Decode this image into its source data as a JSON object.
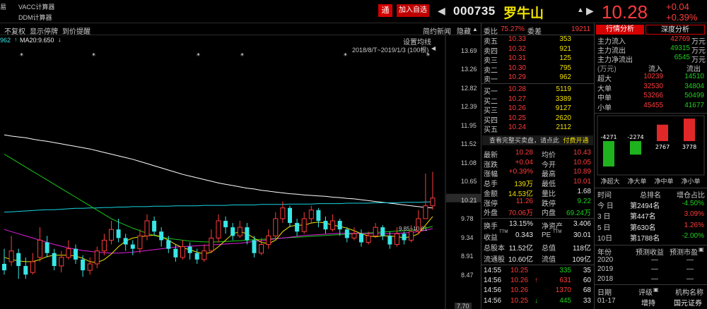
{
  "topbar": {
    "left_char": "易",
    "menu1": "VACC计算器",
    "menu2": "DDM计算器",
    "tong_label": "通",
    "add_fav_label": "加入自选",
    "prev_arrow": "◀",
    "stock_code": "000735",
    "stock_name": "罗牛山",
    "up_icon": "▲",
    "next_arrow": "▶",
    "price": "10.28",
    "change_abs": "+0.04",
    "change_pct": "+0.39%"
  },
  "chart_toolbar": {
    "no_adjust": "不复权",
    "show_suspend": "显示停牌",
    "to_price_alert": "到价提醒",
    "brief_news": "简约新闻",
    "hide": "隐藏",
    "hide_arrow": "▲"
  },
  "chart": {
    "ma_left": "962",
    "ma20_label": "MA20:9.650",
    "settings_label": "设置均线",
    "range_label": "2018/8/T~2019/1/3 (100根)",
    "range_label_end": "◀",
    "range_marker": "9.85~10.01",
    "bottom_value": "7.70",
    "y_labels": [
      "13.69",
      "13.26",
      "12.82",
      "12.39",
      "11.95",
      "11.52",
      "11.08",
      "10.65",
      "10.21",
      "9.78",
      "9.34",
      "8.91",
      "8.47"
    ]
  },
  "chart_data": {
    "type": "candlestick",
    "y_ticks": [
      13.69,
      13.26,
      12.82,
      12.39,
      11.95,
      11.52,
      11.08,
      10.65,
      10.21,
      9.78,
      9.34,
      8.91,
      8.47
    ],
    "ylim": [
      7.7,
      13.9
    ],
    "candles": [
      {
        "o": 8.75,
        "c": 8.6,
        "h": 9.1,
        "l": 8.5
      },
      {
        "o": 8.8,
        "c": 9.05,
        "h": 9.4,
        "l": 8.7
      },
      {
        "o": 9.0,
        "c": 8.7,
        "h": 9.1,
        "l": 8.4
      },
      {
        "o": 8.7,
        "c": 8.5,
        "h": 8.9,
        "l": 8.4
      },
      {
        "o": 8.55,
        "c": 8.8,
        "h": 9.0,
        "l": 8.5
      },
      {
        "o": 8.9,
        "c": 9.3,
        "h": 9.6,
        "l": 8.8
      },
      {
        "o": 9.25,
        "c": 9.0,
        "h": 9.4,
        "l": 8.9
      },
      {
        "o": 9.0,
        "c": 8.7,
        "h": 9.1,
        "l": 8.6
      },
      {
        "o": 8.7,
        "c": 8.9,
        "h": 9.05,
        "l": 8.55
      },
      {
        "o": 8.9,
        "c": 9.1,
        "h": 9.3,
        "l": 8.85
      },
      {
        "o": 9.1,
        "c": 8.85,
        "h": 9.2,
        "l": 8.75
      },
      {
        "o": 8.85,
        "c": 8.6,
        "h": 8.95,
        "l": 8.45
      },
      {
        "o": 8.6,
        "c": 8.75,
        "h": 8.9,
        "l": 8.5
      },
      {
        "o": 8.75,
        "c": 9.05,
        "h": 9.15,
        "l": 8.65
      },
      {
        "o": 9.05,
        "c": 9.3,
        "h": 9.45,
        "l": 8.95
      },
      {
        "o": 9.3,
        "c": 9.55,
        "h": 9.75,
        "l": 9.2
      },
      {
        "o": 9.55,
        "c": 9.35,
        "h": 9.8,
        "l": 9.25
      },
      {
        "o": 9.35,
        "c": 9.2,
        "h": 9.45,
        "l": 9.05
      },
      {
        "o": 9.2,
        "c": 9.1,
        "h": 9.3,
        "l": 8.95
      },
      {
        "o": 9.1,
        "c": 9.4,
        "h": 9.55,
        "l": 9.0
      },
      {
        "o": 9.4,
        "c": 9.75,
        "h": 9.9,
        "l": 9.3
      },
      {
        "o": 9.75,
        "c": 9.5,
        "h": 9.85,
        "l": 9.4
      },
      {
        "o": 9.5,
        "c": 9.3,
        "h": 9.6,
        "l": 9.15
      },
      {
        "o": 9.3,
        "c": 9.1,
        "h": 9.4,
        "l": 9.0
      },
      {
        "o": 9.1,
        "c": 8.9,
        "h": 9.2,
        "l": 8.8
      },
      {
        "o": 8.9,
        "c": 9.15,
        "h": 9.3,
        "l": 8.85
      },
      {
        "o": 9.15,
        "c": 9.0,
        "h": 9.25,
        "l": 8.85
      },
      {
        "o": 9.0,
        "c": 8.85,
        "h": 9.1,
        "l": 8.75
      },
      {
        "o": 8.85,
        "c": 9.05,
        "h": 9.2,
        "l": 8.8
      },
      {
        "o": 9.05,
        "c": 9.35,
        "h": 9.55,
        "l": 9.0
      },
      {
        "o": 9.35,
        "c": 9.75,
        "h": 9.9,
        "l": 9.25
      },
      {
        "o": 9.75,
        "c": 9.6,
        "h": 9.85,
        "l": 9.45
      },
      {
        "o": 9.6,
        "c": 9.4,
        "h": 9.7,
        "l": 9.3
      },
      {
        "o": 9.4,
        "c": 9.6,
        "h": 9.75,
        "l": 9.35
      },
      {
        "o": 9.6,
        "c": 9.3,
        "h": 9.7,
        "l": 9.2
      },
      {
        "o": 9.3,
        "c": 9.0,
        "h": 9.4,
        "l": 8.9
      },
      {
        "o": 9.0,
        "c": 9.2,
        "h": 9.35,
        "l": 8.95
      },
      {
        "o": 9.2,
        "c": 9.4,
        "h": 9.55,
        "l": 9.1
      },
      {
        "o": 9.4,
        "c": 9.8,
        "h": 9.95,
        "l": 9.3
      },
      {
        "o": 9.8,
        "c": 10.05,
        "h": 10.2,
        "l": 9.7
      },
      {
        "o": 10.05,
        "c": 9.7,
        "h": 10.1,
        "l": 9.6
      },
      {
        "o": 9.7,
        "c": 9.5,
        "h": 9.8,
        "l": 9.4
      },
      {
        "o": 9.5,
        "c": 9.8,
        "h": 9.95,
        "l": 9.45
      },
      {
        "o": 9.8,
        "c": 10.0,
        "h": 10.1,
        "l": 9.7
      },
      {
        "o": 10.0,
        "c": 9.75,
        "h": 10.05,
        "l": 9.6
      },
      {
        "o": 9.75,
        "c": 9.55,
        "h": 9.85,
        "l": 9.45
      },
      {
        "o": 9.55,
        "c": 9.75,
        "h": 9.9,
        "l": 9.5
      },
      {
        "o": 9.75,
        "c": 9.55,
        "h": 9.8,
        "l": 9.4
      },
      {
        "o": 9.55,
        "c": 9.35,
        "h": 9.6,
        "l": 9.25
      },
      {
        "o": 9.35,
        "c": 9.45,
        "h": 9.6,
        "l": 9.3
      },
      {
        "o": 9.45,
        "c": 9.25,
        "h": 9.55,
        "l": 9.15
      },
      {
        "o": 9.25,
        "c": 9.4,
        "h": 9.5,
        "l": 9.2
      },
      {
        "o": 9.4,
        "c": 9.6,
        "h": 9.7,
        "l": 9.35
      },
      {
        "o": 9.6,
        "c": 9.4,
        "h": 9.65,
        "l": 9.3
      },
      {
        "o": 9.4,
        "c": 9.2,
        "h": 9.5,
        "l": 9.1
      },
      {
        "o": 9.2,
        "c": 9.45,
        "h": 9.6,
        "l": 9.15
      },
      {
        "o": 9.45,
        "c": 9.3,
        "h": 9.5,
        "l": 9.2
      },
      {
        "o": 9.3,
        "c": 9.5,
        "h": 9.65,
        "l": 9.25
      },
      {
        "o": 9.5,
        "c": 9.8,
        "h": 10.0,
        "l": 9.45
      },
      {
        "o": 9.8,
        "c": 10.1,
        "h": 10.85,
        "l": 9.8
      },
      {
        "o": 10.1,
        "c": 10.28,
        "h": 10.89,
        "l": 10.01
      }
    ],
    "series": [
      {
        "color": "#ffffff",
        "values": [
          11.75,
          11.72,
          11.7,
          11.68,
          11.65,
          11.62,
          11.6,
          11.57,
          11.54,
          11.51,
          11.48,
          11.45,
          11.42,
          11.38,
          11.34,
          11.3,
          11.26,
          11.22,
          11.18,
          11.13,
          11.08,
          11.03,
          10.98,
          10.93,
          10.88,
          10.83,
          10.79,
          10.75,
          10.71,
          10.67,
          10.63,
          10.6,
          10.57,
          10.54,
          10.51,
          10.49,
          10.46,
          10.44,
          10.42,
          10.4,
          10.38,
          10.37,
          10.35,
          10.34,
          10.33,
          10.32,
          10.3,
          10.29,
          10.27,
          10.26,
          10.24,
          10.22,
          10.2,
          10.18,
          10.16,
          10.14,
          10.12,
          10.1,
          10.08,
          10.06,
          10.05
        ]
      },
      {
        "color": "#17d4e0",
        "values": [
          9.95,
          9.96,
          9.97,
          9.98,
          9.99,
          10.0,
          10.01,
          10.01,
          10.02,
          10.03,
          10.04,
          10.04,
          10.05,
          10.05,
          10.06,
          10.06,
          10.07,
          10.07,
          10.08,
          10.08,
          10.08,
          10.09,
          10.09,
          10.09,
          10.1,
          10.1,
          10.1,
          10.1,
          10.11,
          10.11,
          10.11,
          10.11,
          10.12,
          10.12,
          10.12,
          10.12,
          10.13,
          10.13,
          10.13,
          10.13,
          10.14,
          10.14,
          10.14,
          10.14,
          10.15,
          10.15,
          10.15,
          10.15,
          10.16,
          10.16,
          10.16,
          10.16,
          10.17,
          10.17,
          10.17,
          10.17,
          10.18,
          10.18,
          10.18,
          10.19,
          10.19
        ]
      },
      {
        "color": "#19c819",
        "values": [
          11.3,
          11.2,
          11.1,
          11.0,
          10.9,
          10.8,
          10.7,
          10.6,
          10.5,
          10.4,
          10.3,
          10.2,
          10.1,
          10.0,
          9.9,
          9.8,
          9.72,
          9.65,
          9.58,
          9.52,
          9.46,
          9.41,
          9.37,
          9.34,
          9.32,
          9.3,
          9.28,
          9.27,
          9.26,
          9.26,
          9.26,
          9.27,
          9.28,
          9.29,
          9.3,
          9.31,
          9.32,
          9.33,
          9.34,
          9.35,
          9.36,
          9.37,
          9.38,
          9.39,
          9.4,
          9.41,
          9.42,
          9.43,
          9.44,
          9.45,
          9.46,
          9.47,
          9.48,
          9.49,
          9.5,
          9.51,
          9.52,
          9.53,
          9.55,
          9.58,
          9.62
        ]
      },
      {
        "color": "#e020e0",
        "values": [
          9.55,
          9.5,
          9.45,
          9.4,
          9.35,
          9.3,
          9.25,
          9.2,
          9.16,
          9.12,
          9.09,
          9.06,
          9.04,
          9.02,
          9.01,
          9.0,
          9.0,
          9.01,
          9.02,
          9.04,
          9.06,
          9.08,
          9.1,
          9.12,
          9.14,
          9.15,
          9.16,
          9.17,
          9.18,
          9.19,
          9.2,
          9.21,
          9.22,
          9.23,
          9.25,
          9.27,
          9.29,
          9.31,
          9.33,
          9.35,
          9.37,
          9.39,
          9.41,
          9.42,
          9.43,
          9.44,
          9.45,
          9.46,
          9.46,
          9.46,
          9.46,
          9.45,
          9.45,
          9.45,
          9.45,
          9.46,
          9.47,
          9.48,
          9.5,
          9.53,
          9.57
        ]
      },
      {
        "color": "#f0e000",
        "values": [
          8.9,
          8.85,
          8.82,
          8.8,
          8.8,
          8.85,
          8.92,
          8.95,
          8.95,
          8.95,
          8.93,
          8.88,
          8.8,
          8.78,
          8.85,
          8.98,
          9.15,
          9.28,
          9.35,
          9.38,
          9.4,
          9.42,
          9.38,
          9.3,
          9.2,
          9.12,
          9.08,
          9.02,
          8.98,
          9.02,
          9.15,
          9.3,
          9.45,
          9.5,
          9.45,
          9.35,
          9.25,
          9.22,
          9.3,
          9.5,
          9.62,
          9.65,
          9.65,
          9.7,
          9.72,
          9.7,
          9.65,
          9.62,
          9.58,
          9.52,
          9.45,
          9.4,
          9.38,
          9.4,
          9.4,
          9.38,
          9.36,
          9.38,
          9.45,
          9.65,
          9.85
        ]
      }
    ]
  },
  "orderbook": {
    "weibi_label": "委比",
    "weibi_value": "75.27%",
    "weicha_label": "委差",
    "weicha_value": "19211",
    "asks": [
      {
        "label": "卖五",
        "price": "10.33",
        "qty": "353"
      },
      {
        "label": "卖四",
        "price": "10.32",
        "qty": "921"
      },
      {
        "label": "卖三",
        "price": "10.31",
        "qty": "125"
      },
      {
        "label": "卖二",
        "price": "10.30",
        "qty": "795"
      },
      {
        "label": "卖一",
        "price": "10.29",
        "qty": "962"
      }
    ],
    "bids": [
      {
        "label": "买一",
        "price": "10.28",
        "qty": "5119"
      },
      {
        "label": "买二",
        "price": "10.27",
        "qty": "3389"
      },
      {
        "label": "买三",
        "price": "10.26",
        "qty": "9127"
      },
      {
        "label": "买四",
        "price": "10.25",
        "qty": "2620"
      },
      {
        "label": "买五",
        "price": "10.24",
        "qty": "2112"
      }
    ],
    "full_book_prompt": "查看完整买卖盘，请点此",
    "pay_open_label": "付费开通"
  },
  "stats": [
    {
      "l1": "最新",
      "v1": "10.28",
      "l2": "均价",
      "v2": "10.43"
    },
    {
      "l1": "涨跌",
      "v1": "+0.04",
      "l2": "今开",
      "v2": "10.05"
    },
    {
      "l1": "涨幅",
      "v1": "+0.39%",
      "l2": "最高",
      "v2": "10.89"
    },
    {
      "l1": "总手",
      "v1": "139万",
      "l2": "最低",
      "v2": "10.01"
    },
    {
      "l1": "金额",
      "v1": "14.53亿",
      "l2": "量比",
      "v2": "1.68"
    },
    {
      "l1": "涨停",
      "v1": "11.26",
      "l2": "跌停",
      "v2": "9.22"
    },
    {
      "l1": "外盘",
      "v1": "70.06万",
      "l2": "内盘",
      "v2": "69.24万"
    }
  ],
  "stats2": [
    {
      "l1": "换手",
      "v1": "13.15%",
      "l2": "净资产",
      "v2": "3.406"
    },
    {
      "l1": "收益",
      "sup1": "TTM",
      "v1": "0.343",
      "l2": "PE",
      "sup2": "TTM",
      "v2": "30.01"
    },
    {
      "l1": "总股本",
      "v1": "11.52亿",
      "l2": "总值",
      "v2": "118亿"
    },
    {
      "l1": "流通股",
      "v1": "10.60亿",
      "l2": "流值",
      "v2": "109亿"
    }
  ],
  "trades": [
    {
      "time": "14:55",
      "price": "10.25",
      "arrow": "",
      "qty": "335",
      "num": "35"
    },
    {
      "time": "14:56",
      "price": "10.26",
      "arrow": "↑",
      "qty": "631",
      "num": "60"
    },
    {
      "time": "14:56",
      "price": "10.26",
      "arrow": "",
      "qty": "1370",
      "num": "68"
    },
    {
      "time": "14:56",
      "price": "10.25",
      "arrow": "↓",
      "qty": "445",
      "num": "33"
    }
  ],
  "right_panel": {
    "tab_fund": "行情分析",
    "tab_deep": "深度分析",
    "flows": [
      {
        "label": "主力流入",
        "value": "42769",
        "unit": "万元"
      },
      {
        "label": "主力流出",
        "value": "49315",
        "unit": "万元"
      },
      {
        "label": "主力净流出",
        "value": "6545",
        "unit": "万元"
      }
    ],
    "flow_header_unit": "(万元)",
    "flow_header_in": "流入",
    "flow_header_out": "流出",
    "flow_table": [
      {
        "label": "超大",
        "in": "10239",
        "out": "14510"
      },
      {
        "label": "大单",
        "in": "32530",
        "out": "34804"
      },
      {
        "label": "中单",
        "in": "53266",
        "out": "50499"
      },
      {
        "label": "小单",
        "in": "45455",
        "out": "41677"
      }
    ],
    "net_bars": [
      {
        "label": "净超大",
        "value": -4271,
        "text": "-4271"
      },
      {
        "label": "净大单",
        "value": -2274,
        "text": "-2274"
      },
      {
        "label": "净中单",
        "value": 2767,
        "text": "2767"
      },
      {
        "label": "净小单",
        "value": 3778,
        "text": "3778"
      }
    ],
    "rank_header": {
      "time": "时间",
      "rank": "总排名",
      "pct": "增仓占比"
    },
    "ranks": [
      {
        "time": "今 日",
        "rank": "第2494名",
        "pct": "-4.50%"
      },
      {
        "time": "3 日",
        "rank": "第447名",
        "pct": "3.09%"
      },
      {
        "time": "5 日",
        "rank": "第630名",
        "pct": "1.26%"
      },
      {
        "time": "10日",
        "rank": "第1788名",
        "pct": "-2.00%"
      }
    ],
    "est_header": {
      "year": "年份",
      "eps": "预测收益",
      "pe": "预测市盈"
    },
    "estimates": [
      {
        "year": "2020",
        "eps": "—",
        "pe": "—"
      },
      {
        "year": "2019",
        "eps": "—",
        "pe": "—"
      },
      {
        "year": "2018",
        "eps": "—",
        "pe": "—"
      }
    ],
    "rating_header": {
      "date": "日期",
      "rating": "评级",
      "org": "机构名称"
    },
    "ratings": [
      {
        "date": "01-17",
        "rating": "增持",
        "org": "国元证券"
      }
    ]
  }
}
